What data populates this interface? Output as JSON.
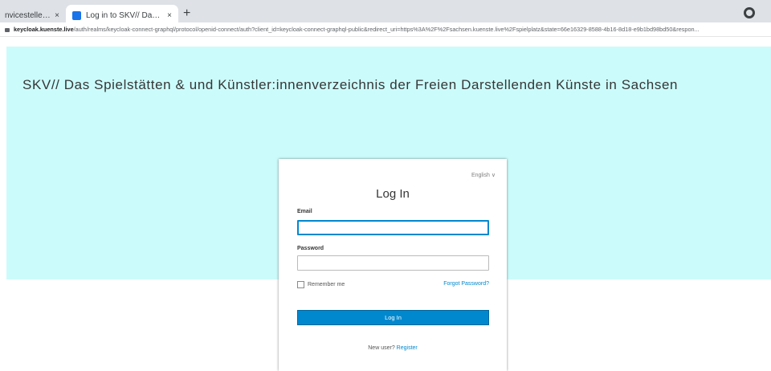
{
  "browser": {
    "tabs": [
      {
        "title": "nvicestelle FREIE S...",
        "close": "×"
      },
      {
        "title": "Log in to SKV// Das Spielstätten...",
        "close": "×"
      }
    ],
    "new_tab": "+",
    "url_host": "keycloak.kuenste.live",
    "url_path": "/auth/realms/keycloak-connect-graphql/protocol/openid-connect/auth?client_id=keycloak-connect-graphql-public&redirect_uri=https%3A%2F%2Fsachsen.kuenste.live%2Fspielplatz&state=66e16329-8588-4b16-8d18-e9b1bd98bd50&respon..."
  },
  "page": {
    "banner_title": "SKV// Das Spielstätten & und Künstler:innenverzeichnis der Freien Darstellenden Künste in Sachsen"
  },
  "login": {
    "language": "English ∨",
    "title": "Log In",
    "email_label": "Email",
    "email_value": "",
    "password_label": "Password",
    "password_value": "",
    "remember_label": "Remember me",
    "forgot_label": "Forgot Password?",
    "submit_label": "Log In",
    "new_user_text": "New user?",
    "register_label": "Register"
  },
  "colors": {
    "banner_bg": "#ccfbfb",
    "accent": "#0088ce"
  }
}
